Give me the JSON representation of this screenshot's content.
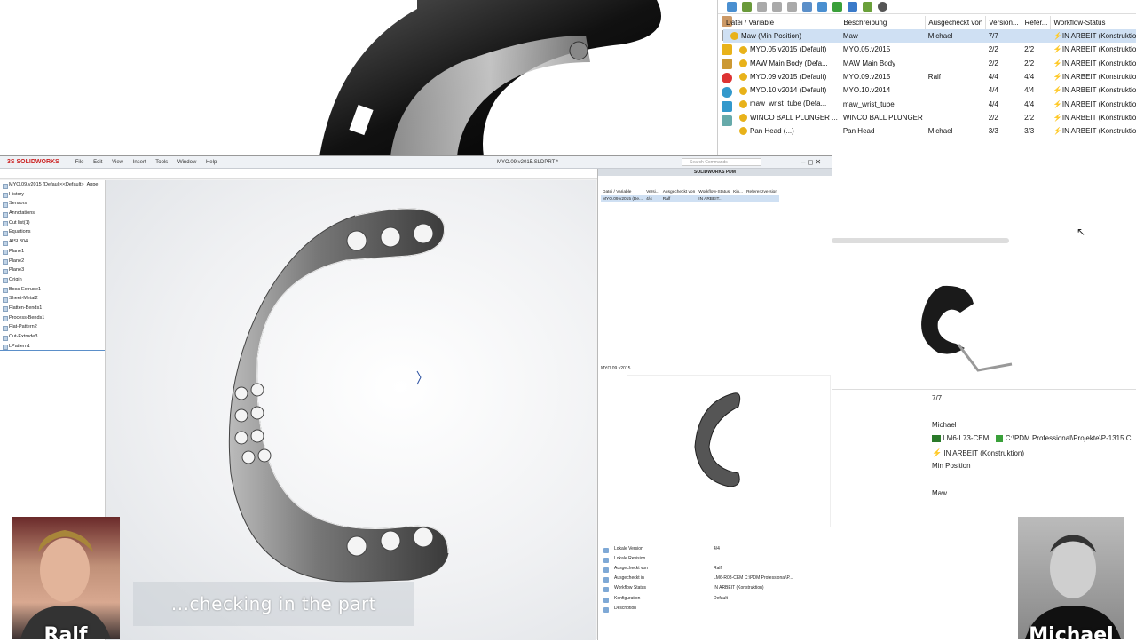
{
  "pdm_top": {
    "columns": [
      "Datei / Variable",
      "Beschreibung",
      "Ausgecheckt von",
      "Version...",
      "Refer...",
      "Workflow-Status"
    ],
    "rows": [
      {
        "name": "Maw  (Min Position)",
        "desc": "Maw",
        "checked_by": "Michael",
        "version": "7/7",
        "ref": "",
        "status": "IN ARBEIT (Konstruktion)",
        "selected": true
      },
      {
        "name": "MYO.05.v2015  (Default)",
        "desc": "MYO.05.v2015",
        "checked_by": "",
        "version": "2/2",
        "ref": "2/2",
        "status": "IN ARBEIT (Konstruktion)"
      },
      {
        "name": "MAW Main Body  (Defa...",
        "desc": "MAW Main Body",
        "checked_by": "",
        "version": "2/2",
        "ref": "2/2",
        "status": "IN ARBEIT (Konstruktion)"
      },
      {
        "name": "MYO.09.v2015  (Default)",
        "desc": "MYO.09.v2015",
        "checked_by": "Ralf",
        "version": "4/4",
        "ref": "4/4",
        "status": "IN ARBEIT (Konstruktion)"
      },
      {
        "name": "MYO.10.v2014  (Default)",
        "desc": "MYO.10.v2014",
        "checked_by": "",
        "version": "4/4",
        "ref": "4/4",
        "status": "IN ARBEIT (Konstruktion)"
      },
      {
        "name": "maw_wrist_tube  (Defa...",
        "desc": "maw_wrist_tube",
        "checked_by": "",
        "version": "4/4",
        "ref": "4/4",
        "status": "IN ARBEIT (Konstruktion)"
      },
      {
        "name": "WINCO BALL PLUNGER ...",
        "desc": "WINCO BALL PLUNGER",
        "checked_by": "",
        "version": "2/2",
        "ref": "2/2",
        "status": "IN ARBEIT (Konstruktion)"
      },
      {
        "name": "Pan Head  (...)",
        "desc": "Pan Head",
        "checked_by": "Michael",
        "version": "3/3",
        "ref": "3/3",
        "status": "IN ARBEIT (Konstruktion)"
      }
    ]
  },
  "solidworks": {
    "logo": "3S SOLIDWORKS",
    "menu": [
      "File",
      "Edit",
      "View",
      "Insert",
      "Tools",
      "Window",
      "Help"
    ],
    "doc_title": "MYO.09.v2015.SLDPRT *",
    "search_placeholder": "Search Commands",
    "tree_root": "MYO.09.v2015  (Default<<Default>_Appe",
    "tree_items": [
      "History",
      "Sensors",
      "Annotations",
      "Cut list(1)",
      "Equations",
      "AISI 304",
      "Plane1",
      "Plane2",
      "Plane3",
      "Origin",
      "Boss-Extrude1",
      "Sheet-Metal2",
      "Flatten-Bends1",
      "Process-Bends1",
      "Flat-Pattern2",
      "Cut-Extrude3",
      "LPattern1"
    ]
  },
  "pdm_mini": {
    "header": "SOLIDWORKS PDM",
    "columns": [
      "Datei / Variable",
      "Versi...",
      "Ausgecheckt von",
      "Workflow-Status",
      "Kin...",
      "Referenzversion"
    ],
    "row": {
      "name": "MYO.09.v2015  (De...",
      "version": "4/4",
      "by": "Ralf",
      "status": "IN ARBEIT..."
    },
    "preview_label": "MYO.09.v2015",
    "props": [
      {
        "k": "Lokale Version",
        "v": "4/4"
      },
      {
        "k": "Lokale Revision",
        "v": ""
      },
      {
        "k": "Ausgecheckt von",
        "v": "Ralf"
      },
      {
        "k": "Ausgecheckt in",
        "v": "LM6-R08-CEM  C:\\PDM Professional\\P..."
      },
      {
        "k": "Workflow Status",
        "v": "IN ARBEIT (Konstruktion)"
      },
      {
        "k": "Konfiguration",
        "v": "Default"
      },
      {
        "k": "Description",
        "v": ""
      }
    ]
  },
  "details": {
    "version": "7/7",
    "checked_out_by": "Michael",
    "checked_out_in": "LM6-L73-CEM",
    "path": "C:\\PDM Professional\\Projekte\\P-1315 C...",
    "status": "IN ARBEIT (Konstruktion)",
    "config": "Min Position",
    "description": "Maw"
  },
  "webcams": {
    "left_name": "Ralf",
    "right_name": "Michael"
  },
  "caption": "...checking in the part",
  "colors": {
    "selection": "#cfe0f3",
    "brand_red": "#cc2222",
    "folder_yellow": "#e8b21a"
  }
}
